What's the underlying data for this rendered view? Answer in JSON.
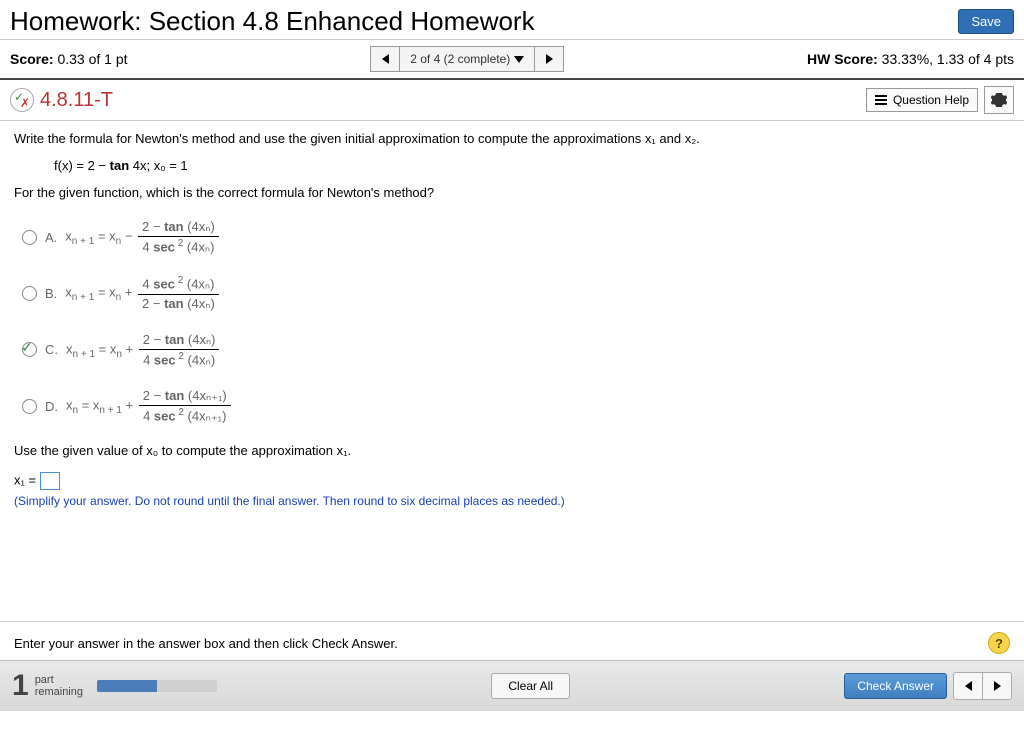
{
  "header": {
    "title": "Homework: Section 4.8 Enhanced Homework",
    "save": "Save"
  },
  "subheader": {
    "score_label": "Score:",
    "score_value": "0.33 of 1 pt",
    "nav_label": "2 of 4 (2 complete)",
    "hw_label": "HW Score:",
    "hw_value": "33.33%, 1.33 of 4 pts"
  },
  "qbar": {
    "id": "4.8.11-T",
    "help": "Question Help"
  },
  "body": {
    "prompt1": "Write the formula for Newton's method and use the given initial approximation to compute the approximations x₁ and x₂.",
    "given_prefix": "f(x) = 2 − ",
    "given_tan": "tan",
    "given_suffix": " 4x;  x₀ = 1",
    "prompt2": "For the given function, which is the correct formula for Newton's method?",
    "choices": {
      "A": {
        "lhs_l": "x",
        "lhs_sub": "n + 1",
        "op": " = x",
        "lhs2_sub": "n",
        "sign": " − ",
        "num_pre": "2 − ",
        "num_b": "tan",
        "num_arg": " (4xₙ)",
        "den_pre": "4 ",
        "den_b": "sec",
        "den_sup": " 2",
        "den_arg": " (4xₙ)"
      },
      "B": {
        "lhs_l": "x",
        "lhs_sub": "n + 1",
        "op": " = x",
        "lhs2_sub": "n",
        "sign": " + ",
        "num_pre": "4 ",
        "num_b": "sec",
        "num_sup": " 2",
        "num_arg": " (4xₙ)",
        "den_pre": "2 − ",
        "den_b": "tan",
        "den_arg": " (4xₙ)"
      },
      "C": {
        "lhs_l": "x",
        "lhs_sub": "n + 1",
        "op": " = x",
        "lhs2_sub": "n",
        "sign": " + ",
        "num_pre": "2 − ",
        "num_b": "tan",
        "num_arg": " (4xₙ)",
        "den_pre": "4 ",
        "den_b": "sec",
        "den_sup": " 2",
        "den_arg": " (4xₙ)"
      },
      "D": {
        "lhs_l": "x",
        "lhs_sub": "n",
        "op": " = x",
        "lhs2_sub": "n + 1",
        "sign": " + ",
        "num_pre": "2 − ",
        "num_b": "tan",
        "num_arg": " (4xₙ₊₁)",
        "den_pre": "4 ",
        "den_b": "sec",
        "den_sup": " 2",
        "den_arg": " (4xₙ₊₁)"
      }
    },
    "prompt3": "Use the given value of x₀ to compute the approximation x₁.",
    "x1_label": "x₁ = ",
    "hint": "(Simplify your answer. Do not round until the final answer. Then round to six decimal places as needed.)"
  },
  "footer_note": "Enter your answer in the answer box and then click Check Answer.",
  "footer": {
    "count": "1",
    "part": "part",
    "remaining": "remaining",
    "clear": "Clear All",
    "check": "Check Answer"
  },
  "labels": {
    "A": "A.",
    "B": "B.",
    "C": "C.",
    "D": "D."
  }
}
